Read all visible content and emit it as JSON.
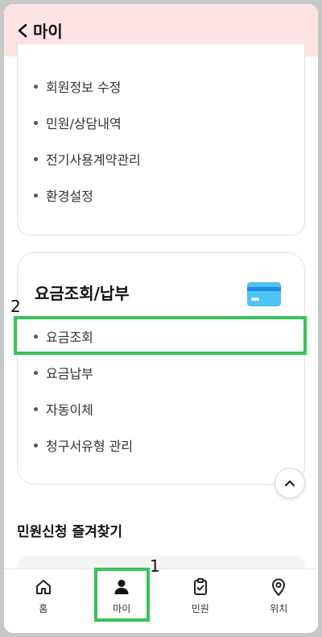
{
  "header": {
    "title": "마이",
    "back_icon": "chevron-left-icon"
  },
  "account_menu": {
    "items": [
      {
        "label": "회원정보 수정"
      },
      {
        "label": "민원/상담내역"
      },
      {
        "label": "전기사용계약관리"
      },
      {
        "label": "환경설정"
      }
    ]
  },
  "billing": {
    "title": "요금조회/납부",
    "icon": "credit-card-icon",
    "items": [
      {
        "label": "요금조회"
      },
      {
        "label": "요금납부"
      },
      {
        "label": "자동이체"
      },
      {
        "label": "청구서유형 관리"
      }
    ]
  },
  "favorites": {
    "title": "민원신청 즐겨찾기"
  },
  "scroll_top_icon": "chevron-up-icon",
  "bottom_nav": {
    "items": [
      {
        "label": "홈",
        "icon": "home-icon"
      },
      {
        "label": "마이",
        "icon": "user-icon"
      },
      {
        "label": "민원",
        "icon": "clipboard-check-icon"
      },
      {
        "label": "위치",
        "icon": "location-pin-icon"
      }
    ]
  },
  "annotations": {
    "label_1": "1",
    "label_2": "2"
  },
  "colors": {
    "header_bg": "#fde3e3",
    "highlight": "#39c257",
    "card_icon": "#4fc3f7"
  }
}
